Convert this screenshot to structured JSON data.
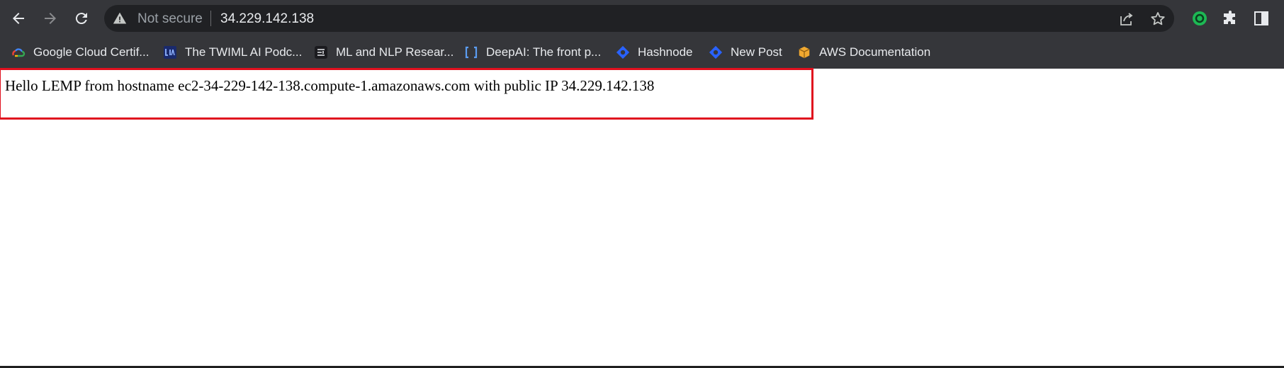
{
  "browser": {
    "omnibox": {
      "security_label": "Not secure",
      "url": "34.229.142.138"
    },
    "bookmarks": [
      {
        "label": "Google Cloud Certif...",
        "icon": "google-cloud-icon"
      },
      {
        "label": "The TWIML AI Podc...",
        "icon": "twiml-icon"
      },
      {
        "label": "ML and NLP Resear...",
        "icon": "ml-nlp-icon"
      },
      {
        "label": "DeepAI: The front p...",
        "icon": "deepai-icon"
      },
      {
        "label": "Hashnode",
        "icon": "hashnode-icon"
      },
      {
        "label": "New Post",
        "icon": "hashnode-icon"
      },
      {
        "label": "AWS Documentation",
        "icon": "aws-docs-icon"
      }
    ],
    "colors": {
      "chrome_bg": "#35363a",
      "omnibox_bg": "#202124",
      "highlight_border": "#e0101e",
      "extension_green": "#1db954"
    }
  },
  "page": {
    "text": "Hello LEMP from hostname ec2-34-229-142-138.compute-1.amazonaws.com with public IP 34.229.142.138"
  }
}
